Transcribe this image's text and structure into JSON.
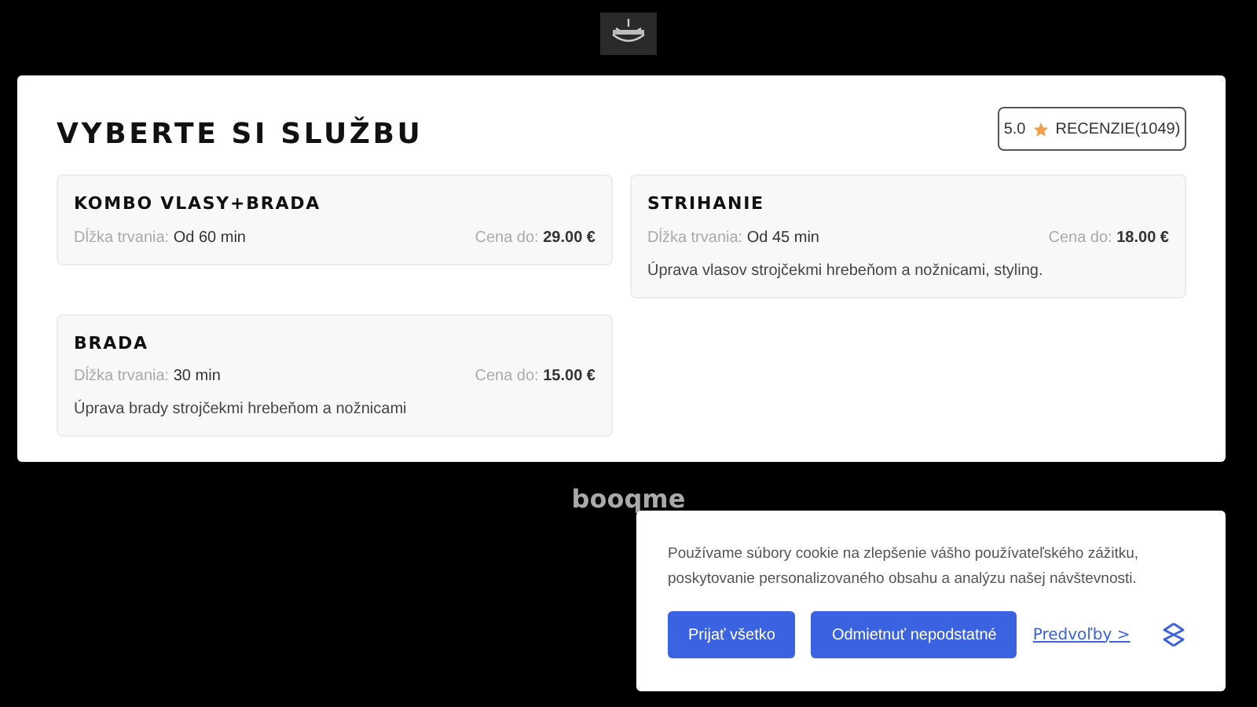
{
  "page": {
    "title": "VYBERTE SI SLUŽBU"
  },
  "rating": {
    "score": "5.0",
    "label": "RECENZIE(1049)"
  },
  "services": [
    {
      "name": "KOMBO VLASY+BRADA",
      "duration_label": "Dĺžka trvania:",
      "duration": "Od 60 min",
      "price_label": "Cena do:",
      "price": "29.00 €"
    },
    {
      "name": "STRIHANIE",
      "duration_label": "Dĺžka trvania:",
      "duration": "Od 45 min",
      "price_label": "Cena do:",
      "price": "18.00 €",
      "description": "Úprava vlasov strojčekmi hrebeňom a nožnicami, styling."
    },
    {
      "name": "BRADA",
      "duration_label": "Dĺžka trvania:",
      "duration": "30 min",
      "price_label": "Cena do:",
      "price": "15.00 €",
      "description": "Úprava brady strojčekmi hrebeňom a nožnicami"
    }
  ],
  "footer": {
    "brand": "booqme"
  },
  "cookie_banner": {
    "text": "Používame súbory cookie na zlepšenie vášho používateľského zážitku, poskytovanie personalizovaného obsahu a analýzu našej návštevnosti.",
    "buttons": [
      "Prijať všetko",
      "Odmietnuť nepodstatné"
    ],
    "link": "Predvoľby >"
  }
}
